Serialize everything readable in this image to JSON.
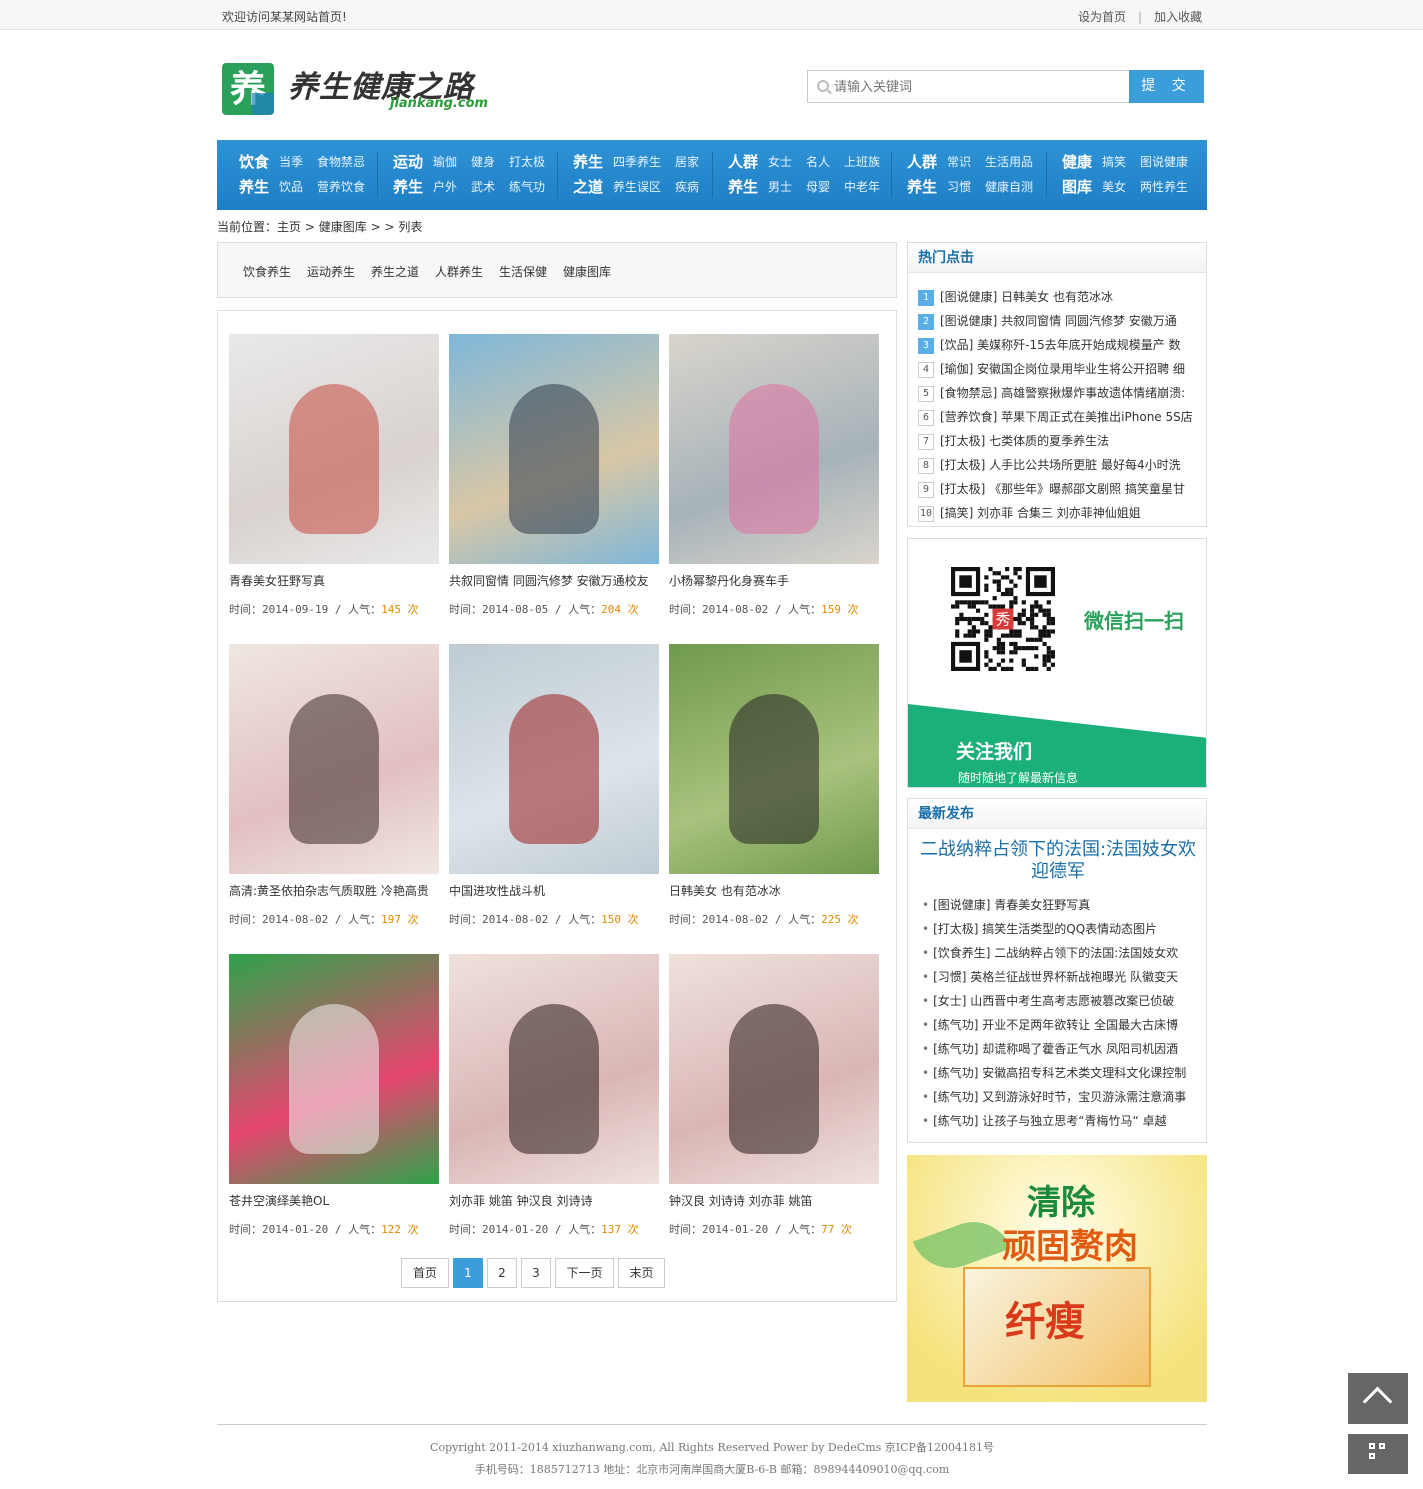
{
  "topbar": {
    "welcome": "欢迎访问某某网站首页!",
    "set_home": "设为首页",
    "separator": "|",
    "add_fav": "加入收藏"
  },
  "header": {
    "logo_char": "养",
    "site_title": "养生健康之路",
    "site_domain": "jiankang.com",
    "search_placeholder": "请输入关键词",
    "search_button": "提 交"
  },
  "nav": {
    "groups": [
      {
        "head": [
          "饮食",
          "养生"
        ],
        "row1": [
          "当季",
          "食物禁忌"
        ],
        "row2": [
          "饮品",
          "营养饮食"
        ]
      },
      {
        "head": [
          "运动",
          "养生"
        ],
        "row1": [
          "瑜伽",
          "健身",
          "打太极"
        ],
        "row2": [
          "户外",
          "武术",
          "练气功"
        ]
      },
      {
        "head": [
          "养生",
          "之道"
        ],
        "row1": [
          "四季养生",
          "居家"
        ],
        "row2": [
          "养生误区",
          "疾病"
        ]
      },
      {
        "head": [
          "人群",
          "养生"
        ],
        "row1": [
          "女士",
          "名人",
          "上班族"
        ],
        "row2": [
          "男士",
          "母婴",
          "中老年"
        ]
      },
      {
        "head": [
          "人群",
          "养生"
        ],
        "row1": [
          "常识",
          "生活用品"
        ],
        "row2": [
          "习惯",
          "健康自测"
        ]
      },
      {
        "head": [
          "健康",
          "图库"
        ],
        "row1": [
          "搞笑",
          "图说健康"
        ],
        "row2": [
          "美女",
          "两性养生"
        ]
      }
    ]
  },
  "breadcrumb": {
    "prefix": "当前位置：",
    "home": "主页",
    "sep1": ">",
    "section": "健康图库",
    "sep2": "> >",
    "current": "列表"
  },
  "categories": [
    "饮食养生",
    "运动养生",
    "养生之道",
    "人群养生",
    "生活保健",
    "健康图库"
  ],
  "labels": {
    "time": "时间：",
    "slash": " / ",
    "popularity": "人气：",
    "times_unit": "次"
  },
  "items": [
    {
      "title": "青春美女狂野写真",
      "date": "2014-09-19",
      "views": "145"
    },
    {
      "title": "共叙同窗情 同圆汽修梦 安徽万通校友",
      "date": "2014-08-05",
      "views": "204"
    },
    {
      "title": "小杨幂黎丹化身赛车手",
      "date": "2014-08-02",
      "views": "159"
    },
    {
      "title": "高清:黄圣依拍杂志气质取胜 冷艳高贵",
      "date": "2014-08-02",
      "views": "197"
    },
    {
      "title": "中国进攻性战斗机",
      "date": "2014-08-02",
      "views": "150"
    },
    {
      "title": "日韩美女 也有范冰冰",
      "date": "2014-08-02",
      "views": "225"
    },
    {
      "title": "苍井空演绎美艳OL",
      "date": "2014-01-20",
      "views": "122"
    },
    {
      "title": "刘亦菲 姚笛 钟汉良 刘诗诗",
      "date": "2014-01-20",
      "views": "137"
    },
    {
      "title": "钟汉良 刘诗诗 刘亦菲 姚笛",
      "date": "2014-01-20",
      "views": "77"
    }
  ],
  "pager": {
    "first": "首页",
    "pages": [
      "1",
      "2",
      "3"
    ],
    "current": "1",
    "next": "下一页",
    "last": "末页"
  },
  "hot": {
    "title": "热门点击",
    "items": [
      {
        "num": "1",
        "text": "[图说健康] 日韩美女 也有范冰冰"
      },
      {
        "num": "2",
        "text": "[图说健康] 共叙同窗情 同圆汽修梦 安徽万通"
      },
      {
        "num": "3",
        "text": "[饮品] 美媒称歼-15去年底开始成规模量产 数"
      },
      {
        "num": "4",
        "text": "[瑜伽] 安徽国企岗位录用毕业生将公开招聘 细"
      },
      {
        "num": "5",
        "text": "[食物禁忌] 高雄警察揪爆炸事故遗体情绪崩溃:"
      },
      {
        "num": "6",
        "text": "[营养饮食] 苹果下周正式在美推出iPhone 5S店"
      },
      {
        "num": "7",
        "text": "[打太极] 七类体质的夏季养生法"
      },
      {
        "num": "8",
        "text": "[打太极] 人手比公共场所更脏 最好每4小时洗"
      },
      {
        "num": "9",
        "text": "[打太极] 《那些年》曝郝邵文剧照 搞笑童星甘"
      },
      {
        "num": "10",
        "text": "[搞笑] 刘亦菲 合集三 刘亦菲神仙姐姐"
      }
    ]
  },
  "qr": {
    "scan": "微信扫一扫",
    "follow": "关注我们",
    "follow_sub": "随时随地了解最新信息",
    "qr_center": "秀"
  },
  "latest": {
    "title": "最新发布",
    "headline": "二战纳粹占领下的法国:法国妓女欢迎德军",
    "items": [
      "[图说健康] 青春美女狂野写真",
      "[打太极] 搞笑生活类型的QQ表情动态图片",
      "[饮食养生] 二战纳粹占领下的法国:法国妓女欢",
      "[习惯] 英格兰征战世界杯新战袍曝光 队徽变天",
      "[女士] 山西晋中考生高考志愿被篡改案已侦破",
      "[练气功] 开业不足两年欲转让 全国最大古床博",
      "[练气功] 却谎称喝了藿香正气水 凤阳司机因酒",
      "[练气功] 安徽高招专科艺术类文理科文化课控制",
      "[练气功] 又到游泳好时节，宝贝游泳需注意滴事",
      "[练气功] 让孩子与独立思考“青梅竹马“ 卓越"
    ]
  },
  "ad": {
    "line1": "清除",
    "line2": "顽固赘肉",
    "brand": "纤瘦"
  },
  "footer": {
    "line1": "Copyright 2011-2014 xiuzhanwang.com, All Rights Reserved Power by DedeCms 京ICP备12004181号",
    "line2": "手机号码：1885712713 地址：北京市河南岸国商大厦B-6-B 邮箱：898944409010@qq.com"
  },
  "colors": {
    "nav_blue": "#1f7fc4",
    "accent_blue": "#3c9ddb",
    "views_orange": "#e08a00",
    "qr_green": "#1bb07a"
  }
}
